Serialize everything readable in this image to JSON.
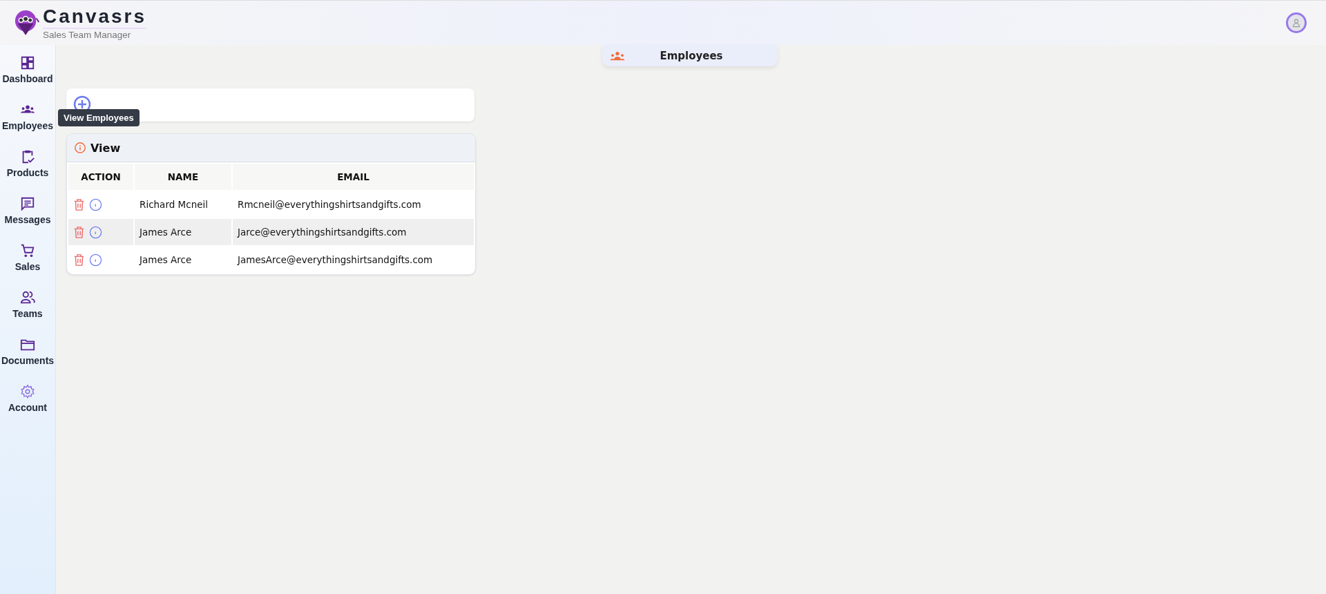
{
  "header": {
    "brand": "Canvasrs",
    "tagline": "Sales Team Manager"
  },
  "sidebar": {
    "items": [
      {
        "label": "Dashboard",
        "kind": "dashboard"
      },
      {
        "label": "Employees",
        "kind": "employees"
      },
      {
        "label": "Products",
        "kind": "products"
      },
      {
        "label": "Messages",
        "kind": "messages"
      },
      {
        "label": "Sales",
        "kind": "sales"
      },
      {
        "label": "Teams",
        "kind": "teams"
      },
      {
        "label": "Documents",
        "kind": "documents"
      },
      {
        "label": "Account",
        "kind": "account"
      }
    ]
  },
  "tooltip": "View Employees",
  "page_title": "Employees",
  "panel": {
    "title": "View",
    "columns": [
      "ACTION",
      "NAME",
      "EMAIL"
    ],
    "rows": [
      {
        "name": "Richard Mcneil",
        "email": "Rmcneil@everythingshirtsandgifts.com",
        "hovered": false
      },
      {
        "name": "James Arce",
        "email": "Jarce@everythingshirtsandgifts.com",
        "hovered": true
      },
      {
        "name": "James Arce",
        "email": "JamesArce@everythingshirtsandgifts.com",
        "hovered": false
      }
    ]
  }
}
